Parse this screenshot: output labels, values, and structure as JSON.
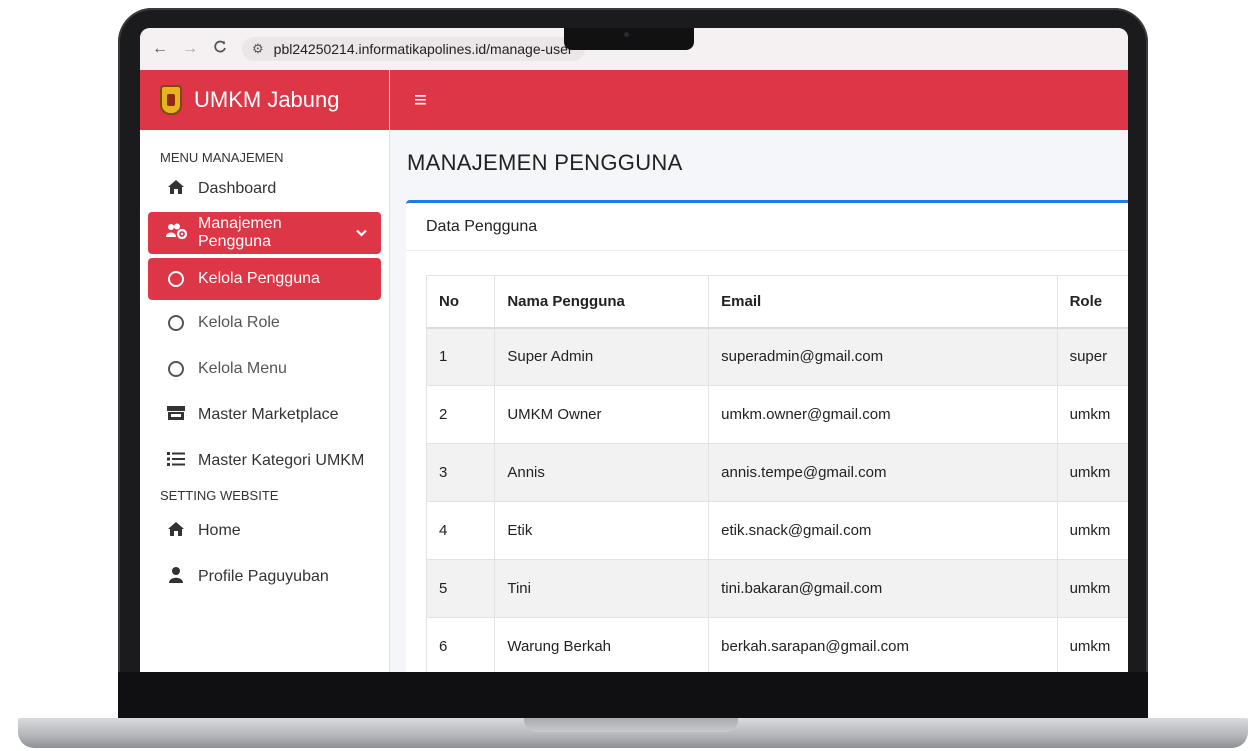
{
  "browser": {
    "back_icon": "←",
    "forward_icon": "→",
    "reload_icon": "C",
    "site_info_icon": "⚙",
    "url": "pbl24250214.informatikapolines.id/manage-user"
  },
  "app": {
    "brand": "UMKM Jabung",
    "hamburger": "≡",
    "accent_color": "#dd3646",
    "card_accent": "#1f7bea"
  },
  "sidebar": {
    "section_menu": "MENU MANAJEMEN",
    "section_setting": "SETTING WEBSITE",
    "items": [
      {
        "label": "Dashboard",
        "icon": "home-icon"
      },
      {
        "label": "Manajemen Pengguna",
        "icon": "users-cog-icon"
      },
      {
        "label": "Kelola Pengguna",
        "icon": "circle-icon"
      },
      {
        "label": "Kelola Role",
        "icon": "circle-icon"
      },
      {
        "label": "Kelola Menu",
        "icon": "circle-icon"
      },
      {
        "label": "Master Marketplace",
        "icon": "store-icon"
      },
      {
        "label": "Master Kategori UMKM",
        "icon": "list-icon"
      },
      {
        "label": "Home",
        "icon": "home-icon"
      },
      {
        "label": "Profile Paguyuban",
        "icon": "user-icon"
      }
    ]
  },
  "main": {
    "page_title": "MANAJEMEN PENGGUNA",
    "card_title": "Data Pengguna",
    "table": {
      "headers": [
        "No",
        "Nama Pengguna",
        "Email",
        "Role"
      ],
      "rows": [
        [
          "1",
          "Super Admin",
          "superadmin@gmail.com",
          "super"
        ],
        [
          "2",
          "UMKM Owner",
          "umkm.owner@gmail.com",
          "umkm"
        ],
        [
          "3",
          "Annis",
          "annis.tempe@gmail.com",
          "umkm"
        ],
        [
          "4",
          "Etik",
          "etik.snack@gmail.com",
          "umkm"
        ],
        [
          "5",
          "Tini",
          "tini.bakaran@gmail.com",
          "umkm"
        ],
        [
          "6",
          "Warung Berkah",
          "berkah.sarapan@gmail.com",
          "umkm"
        ]
      ]
    }
  }
}
